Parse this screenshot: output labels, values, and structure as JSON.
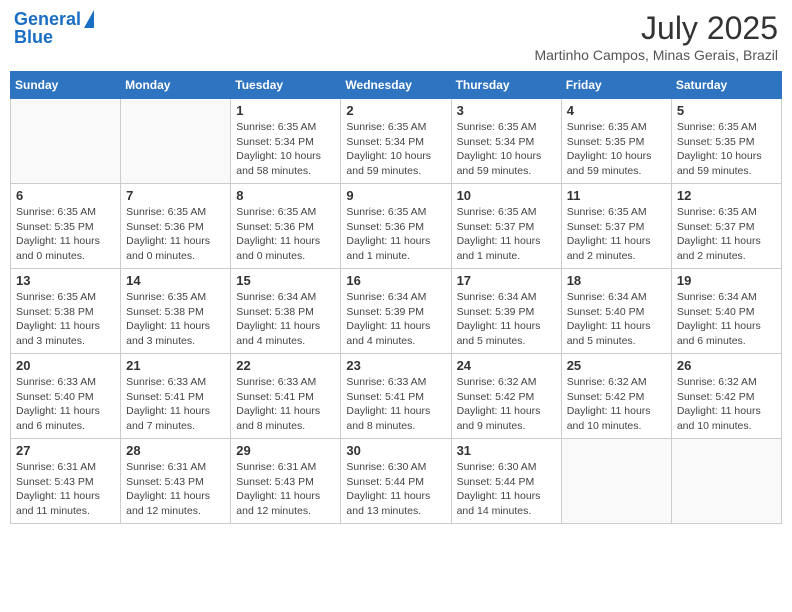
{
  "logo": {
    "line1": "General",
    "line2": "Blue"
  },
  "title": "July 2025",
  "subtitle": "Martinho Campos, Minas Gerais, Brazil",
  "days_of_week": [
    "Sunday",
    "Monday",
    "Tuesday",
    "Wednesday",
    "Thursday",
    "Friday",
    "Saturday"
  ],
  "weeks": [
    [
      {
        "day": "",
        "info": ""
      },
      {
        "day": "",
        "info": ""
      },
      {
        "day": "1",
        "info": "Sunrise: 6:35 AM\nSunset: 5:34 PM\nDaylight: 10 hours and 58 minutes."
      },
      {
        "day": "2",
        "info": "Sunrise: 6:35 AM\nSunset: 5:34 PM\nDaylight: 10 hours and 59 minutes."
      },
      {
        "day": "3",
        "info": "Sunrise: 6:35 AM\nSunset: 5:34 PM\nDaylight: 10 hours and 59 minutes."
      },
      {
        "day": "4",
        "info": "Sunrise: 6:35 AM\nSunset: 5:35 PM\nDaylight: 10 hours and 59 minutes."
      },
      {
        "day": "5",
        "info": "Sunrise: 6:35 AM\nSunset: 5:35 PM\nDaylight: 10 hours and 59 minutes."
      }
    ],
    [
      {
        "day": "6",
        "info": "Sunrise: 6:35 AM\nSunset: 5:35 PM\nDaylight: 11 hours and 0 minutes."
      },
      {
        "day": "7",
        "info": "Sunrise: 6:35 AM\nSunset: 5:36 PM\nDaylight: 11 hours and 0 minutes."
      },
      {
        "day": "8",
        "info": "Sunrise: 6:35 AM\nSunset: 5:36 PM\nDaylight: 11 hours and 0 minutes."
      },
      {
        "day": "9",
        "info": "Sunrise: 6:35 AM\nSunset: 5:36 PM\nDaylight: 11 hours and 1 minute."
      },
      {
        "day": "10",
        "info": "Sunrise: 6:35 AM\nSunset: 5:37 PM\nDaylight: 11 hours and 1 minute."
      },
      {
        "day": "11",
        "info": "Sunrise: 6:35 AM\nSunset: 5:37 PM\nDaylight: 11 hours and 2 minutes."
      },
      {
        "day": "12",
        "info": "Sunrise: 6:35 AM\nSunset: 5:37 PM\nDaylight: 11 hours and 2 minutes."
      }
    ],
    [
      {
        "day": "13",
        "info": "Sunrise: 6:35 AM\nSunset: 5:38 PM\nDaylight: 11 hours and 3 minutes."
      },
      {
        "day": "14",
        "info": "Sunrise: 6:35 AM\nSunset: 5:38 PM\nDaylight: 11 hours and 3 minutes."
      },
      {
        "day": "15",
        "info": "Sunrise: 6:34 AM\nSunset: 5:38 PM\nDaylight: 11 hours and 4 minutes."
      },
      {
        "day": "16",
        "info": "Sunrise: 6:34 AM\nSunset: 5:39 PM\nDaylight: 11 hours and 4 minutes."
      },
      {
        "day": "17",
        "info": "Sunrise: 6:34 AM\nSunset: 5:39 PM\nDaylight: 11 hours and 5 minutes."
      },
      {
        "day": "18",
        "info": "Sunrise: 6:34 AM\nSunset: 5:40 PM\nDaylight: 11 hours and 5 minutes."
      },
      {
        "day": "19",
        "info": "Sunrise: 6:34 AM\nSunset: 5:40 PM\nDaylight: 11 hours and 6 minutes."
      }
    ],
    [
      {
        "day": "20",
        "info": "Sunrise: 6:33 AM\nSunset: 5:40 PM\nDaylight: 11 hours and 6 minutes."
      },
      {
        "day": "21",
        "info": "Sunrise: 6:33 AM\nSunset: 5:41 PM\nDaylight: 11 hours and 7 minutes."
      },
      {
        "day": "22",
        "info": "Sunrise: 6:33 AM\nSunset: 5:41 PM\nDaylight: 11 hours and 8 minutes."
      },
      {
        "day": "23",
        "info": "Sunrise: 6:33 AM\nSunset: 5:41 PM\nDaylight: 11 hours and 8 minutes."
      },
      {
        "day": "24",
        "info": "Sunrise: 6:32 AM\nSunset: 5:42 PM\nDaylight: 11 hours and 9 minutes."
      },
      {
        "day": "25",
        "info": "Sunrise: 6:32 AM\nSunset: 5:42 PM\nDaylight: 11 hours and 10 minutes."
      },
      {
        "day": "26",
        "info": "Sunrise: 6:32 AM\nSunset: 5:42 PM\nDaylight: 11 hours and 10 minutes."
      }
    ],
    [
      {
        "day": "27",
        "info": "Sunrise: 6:31 AM\nSunset: 5:43 PM\nDaylight: 11 hours and 11 minutes."
      },
      {
        "day": "28",
        "info": "Sunrise: 6:31 AM\nSunset: 5:43 PM\nDaylight: 11 hours and 12 minutes."
      },
      {
        "day": "29",
        "info": "Sunrise: 6:31 AM\nSunset: 5:43 PM\nDaylight: 11 hours and 12 minutes."
      },
      {
        "day": "30",
        "info": "Sunrise: 6:30 AM\nSunset: 5:44 PM\nDaylight: 11 hours and 13 minutes."
      },
      {
        "day": "31",
        "info": "Sunrise: 6:30 AM\nSunset: 5:44 PM\nDaylight: 11 hours and 14 minutes."
      },
      {
        "day": "",
        "info": ""
      },
      {
        "day": "",
        "info": ""
      }
    ]
  ]
}
